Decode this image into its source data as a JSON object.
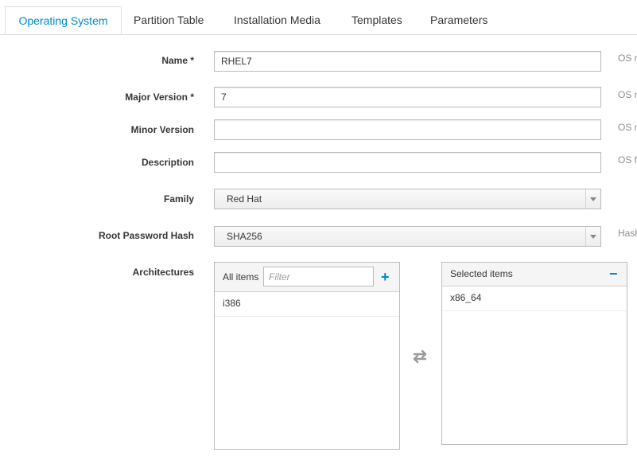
{
  "tabs": [
    {
      "label": "Operating System",
      "active": true
    },
    {
      "label": "Partition Table",
      "active": false
    },
    {
      "label": "Installation Media",
      "active": false
    },
    {
      "label": "Templates",
      "active": false
    },
    {
      "label": "Parameters",
      "active": false
    }
  ],
  "form": {
    "name": {
      "label": "Name *",
      "value": "RHEL7",
      "help": "OS n"
    },
    "major_version": {
      "label": "Major Version *",
      "value": "7",
      "help": "OS n"
    },
    "minor_version": {
      "label": "Minor Version",
      "value": "",
      "help": "OS n"
    },
    "description": {
      "label": "Description",
      "value": "",
      "help": "OS fi"
    },
    "family": {
      "label": "Family",
      "value": "Red Hat"
    },
    "root_password_hash": {
      "label": "Root Password Hash",
      "value": "SHA256",
      "help": "Hash"
    },
    "architectures": {
      "label": "Architectures",
      "all_items_title": "All items",
      "filter_placeholder": "Filter",
      "add_glyph": "+",
      "available": [
        "i386"
      ],
      "selected_title": "Selected items",
      "remove_glyph": "−",
      "selected": [
        "x86_64"
      ]
    }
  },
  "colors": {
    "accent": "#0088ce",
    "text": "#363636",
    "muted": "#8b8d8f",
    "border": "#bbbbbb"
  },
  "icons": {
    "swap": "swap-arrows-icon",
    "select_arrow": "caret-down-icon",
    "add": "plus-icon",
    "remove": "minus-icon"
  }
}
